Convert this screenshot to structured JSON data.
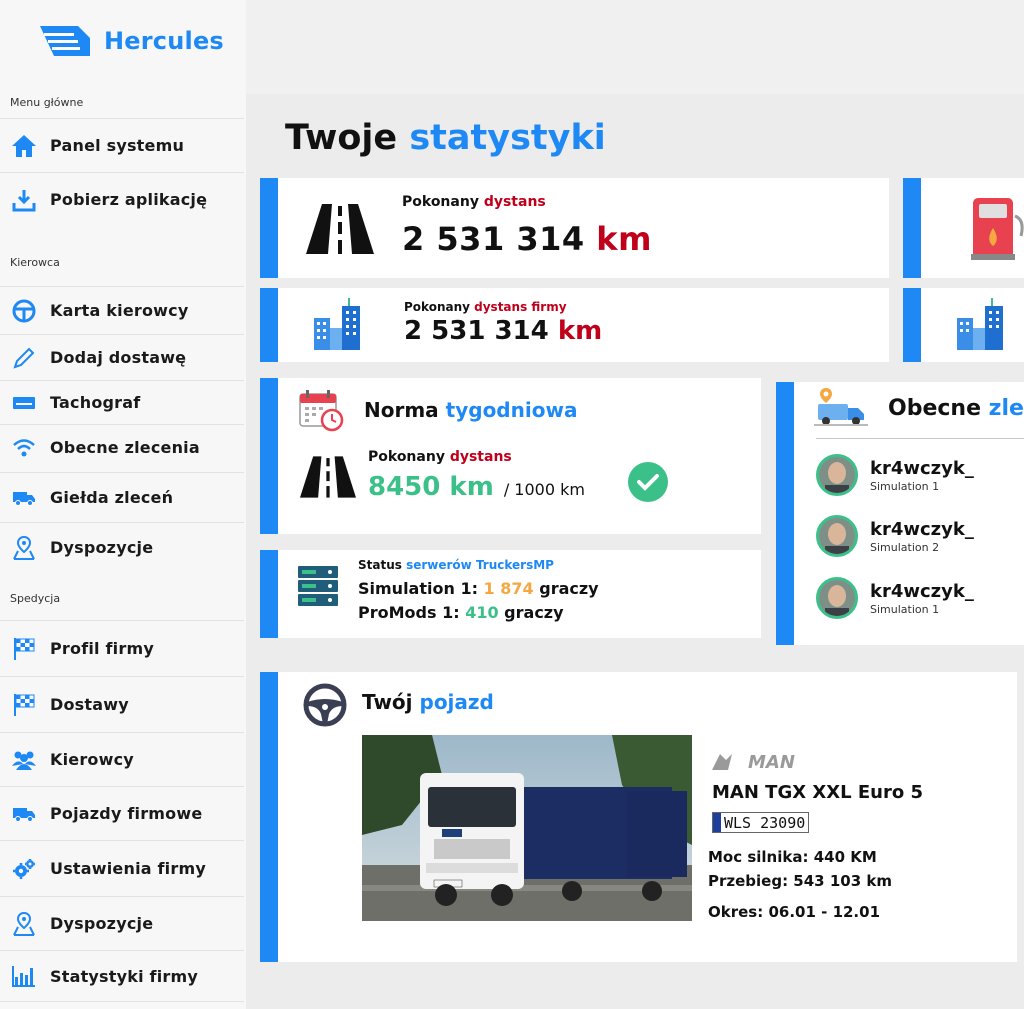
{
  "app": {
    "name": "Hercules"
  },
  "sidebar": {
    "sections": [
      "Menu główne",
      "Kierowca",
      "Spedycja"
    ],
    "items": [
      {
        "label": "Panel systemu",
        "icon": "home-icon"
      },
      {
        "label": "Pobierz aplikację",
        "icon": "download-icon"
      },
      {
        "label": "Karta kierowcy",
        "icon": "steering-wheel-icon"
      },
      {
        "label": "Dodaj dostawę",
        "icon": "pencil-icon"
      },
      {
        "label": "Tachograf",
        "icon": "tachograph-icon"
      },
      {
        "label": "Obecne zlecenia",
        "icon": "wifi-icon"
      },
      {
        "label": "Giełda zleceń",
        "icon": "truck-icon"
      },
      {
        "label": "Dyspozycje",
        "icon": "map-pin-icon"
      },
      {
        "label": "Profil firmy",
        "icon": "checkered-flag-icon"
      },
      {
        "label": "Dostawy",
        "icon": "checkered-flag-icon"
      },
      {
        "label": "Kierowcy",
        "icon": "users-icon"
      },
      {
        "label": "Pojazdy firmowe",
        "icon": "truck-icon"
      },
      {
        "label": "Ustawienia firmy",
        "icon": "gears-icon"
      },
      {
        "label": "Dyspozycje",
        "icon": "map-pin-icon"
      },
      {
        "label": "Statystyki firmy",
        "icon": "bar-chart-icon"
      }
    ]
  },
  "page": {
    "title_a": "Twoje",
    "title_b": "statystyki"
  },
  "stats": {
    "distance": {
      "label_a": "Pokonany",
      "label_b": "dystans",
      "value": "2 531 314",
      "unit": "km"
    },
    "company_distance": {
      "label_a": "Pokonany",
      "label_b": "dystans firmy",
      "value": "2 531 314",
      "unit": "km"
    }
  },
  "weekly": {
    "title_a": "Norma",
    "title_b": "tygodniowa",
    "label_a": "Pokonany",
    "label_b": "dystans",
    "value": "8450 km",
    "target": "/ 1000 km"
  },
  "servers": {
    "title_a": "Status",
    "title_b": "serwerów TruckersMP",
    "rows": [
      {
        "name": "Simulation 1:",
        "count": "1 874",
        "suffix": "graczy"
      },
      {
        "name": "ProMods 1:",
        "count": "410",
        "suffix": "graczy"
      }
    ]
  },
  "current_jobs": {
    "title_a": "Obecne",
    "title_b": "zle",
    "drivers": [
      {
        "name": "kr4wczyk_",
        "server": "Simulation 1"
      },
      {
        "name": "kr4wczyk_",
        "server": "Simulation 2"
      },
      {
        "name": "kr4wczyk_",
        "server": "Simulation 1"
      }
    ]
  },
  "vehicle": {
    "title_a": "Twój",
    "title_b": "pojazd",
    "brand": "MAN",
    "model": "MAN TGX XXL Euro 5",
    "plate": "WLS 23090",
    "power": "Moc silnika: 440 KM",
    "mileage": "Przebieg: 543 103 km",
    "period": "Okres: 06.01 - 12.01"
  },
  "colors": {
    "accent": "#1e88f5",
    "red": "#c0001a",
    "green": "#3cc08a",
    "orange": "#f5a742"
  }
}
